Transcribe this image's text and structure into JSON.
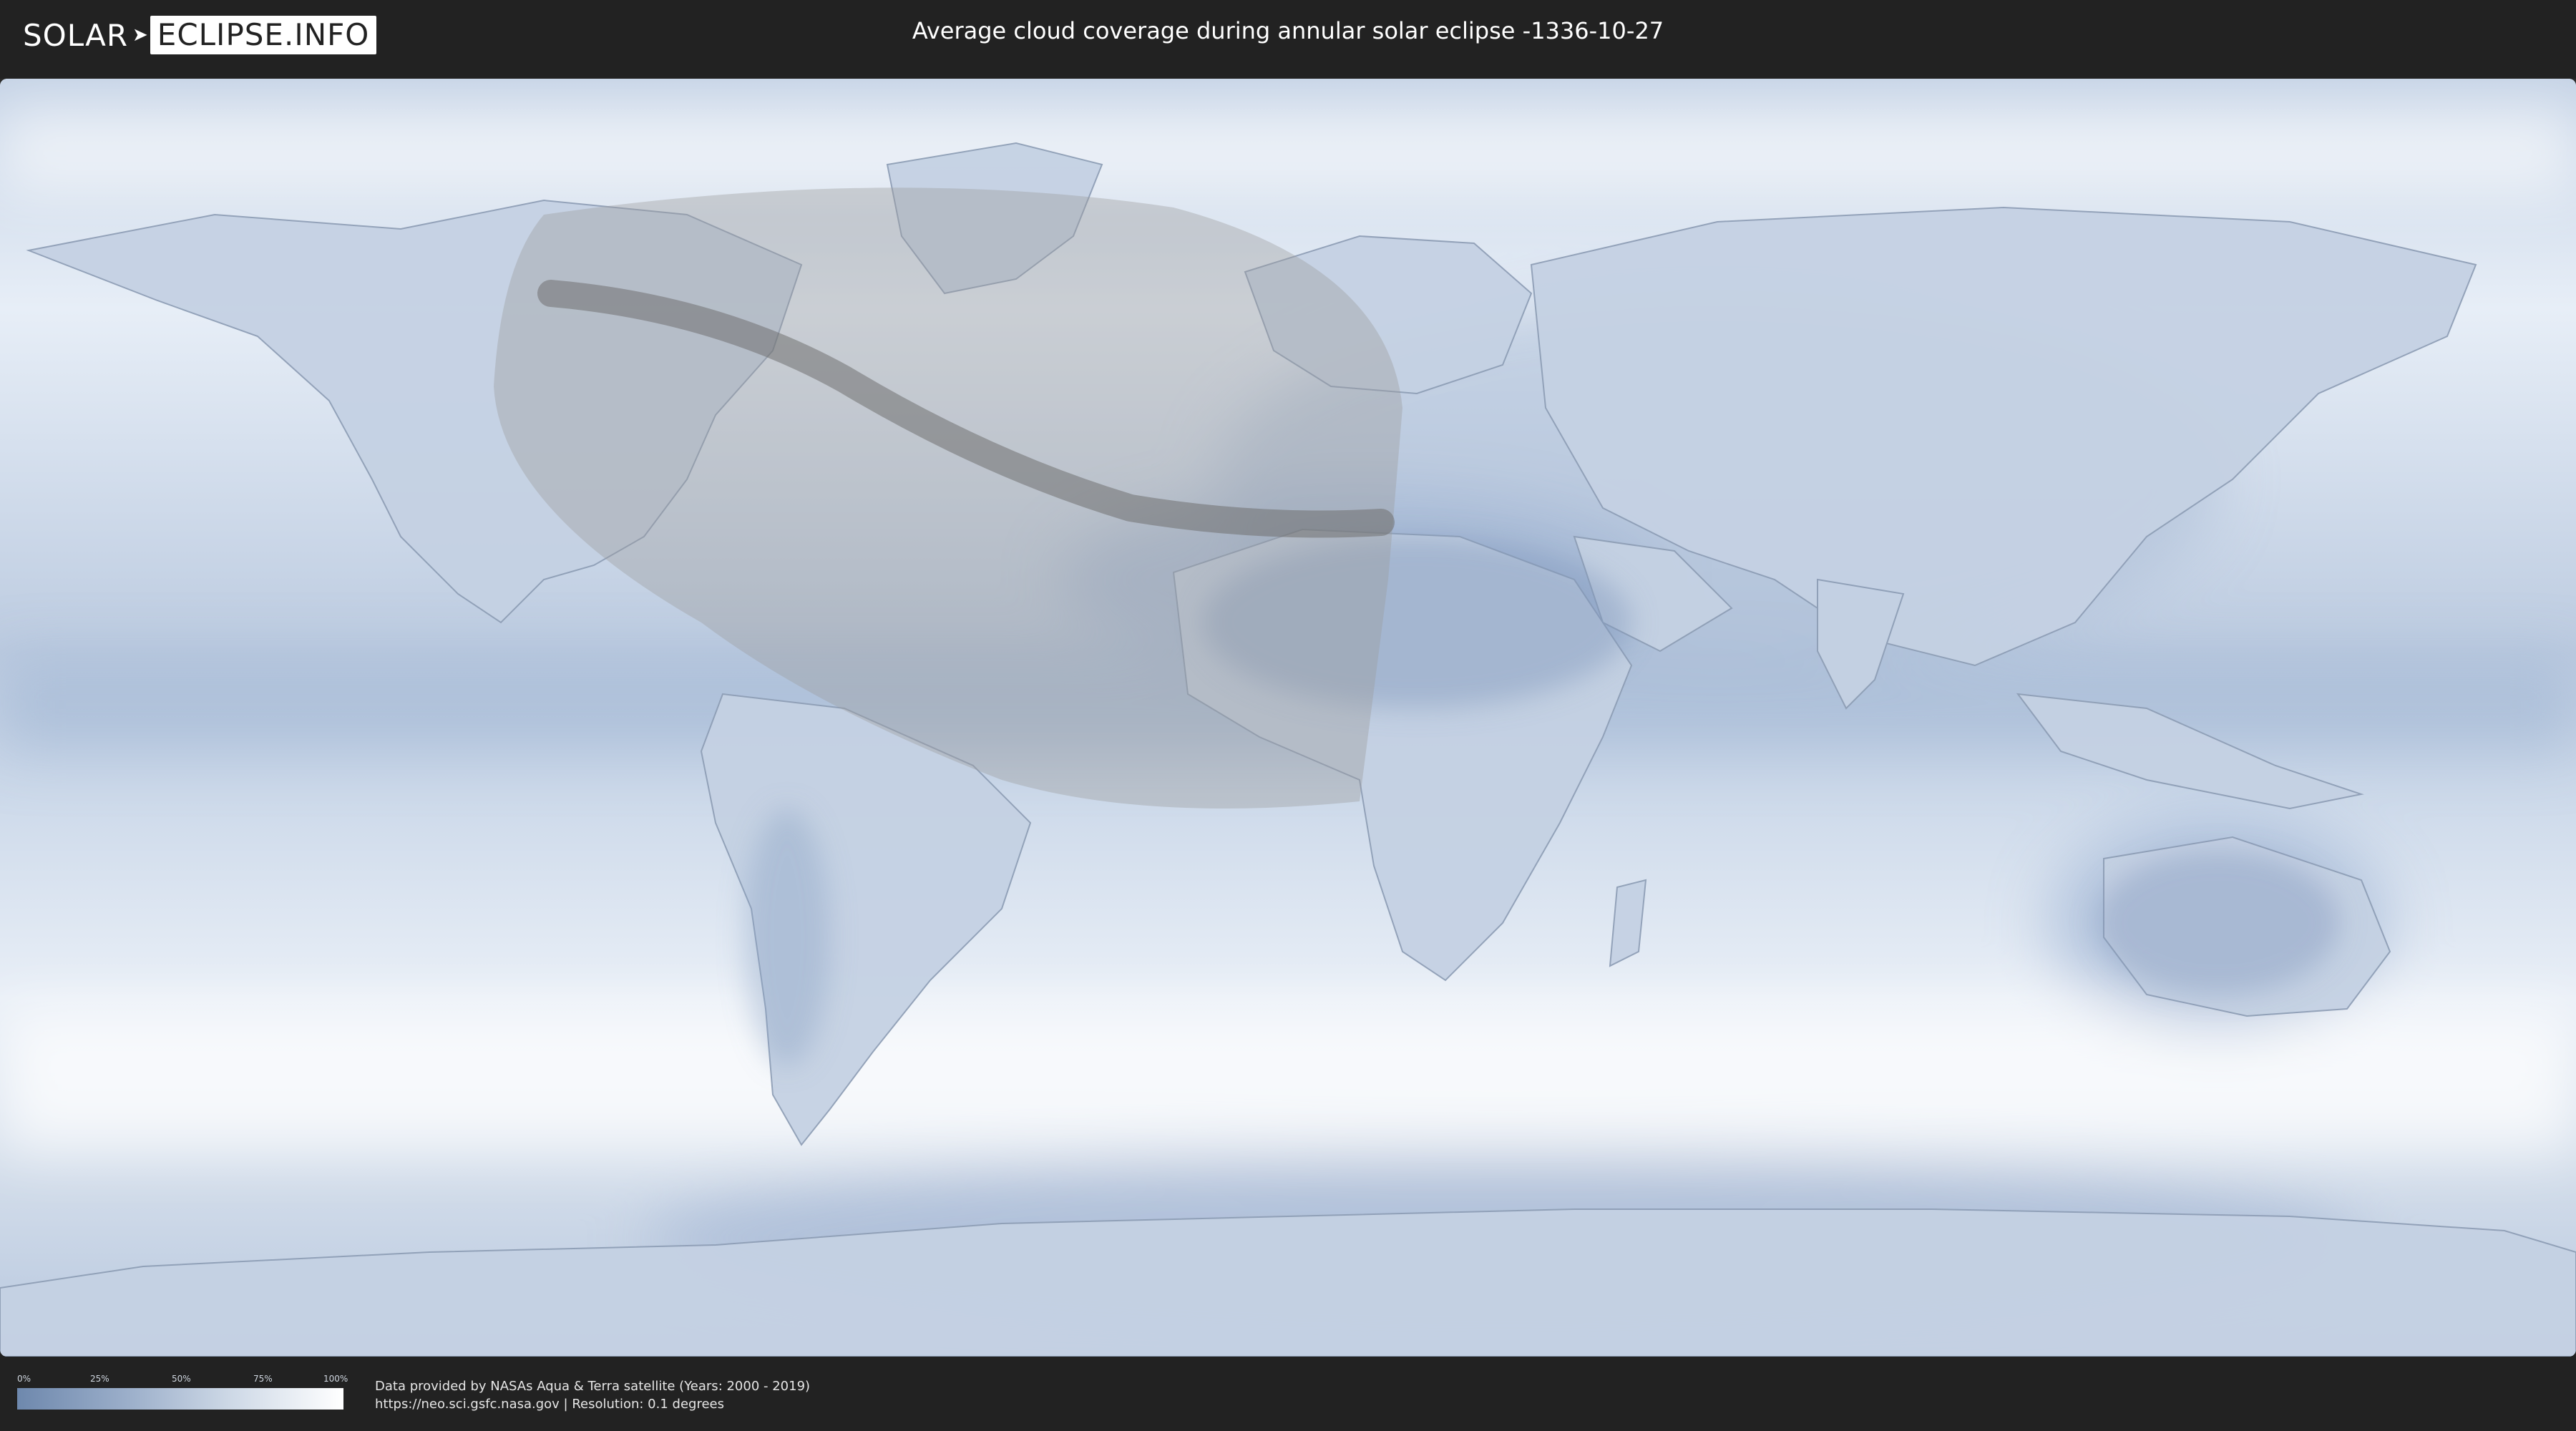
{
  "header": {
    "logo_left": "SOLAR",
    "logo_right": "ECLIPSE.INFO",
    "title": "Average cloud coverage during annular solar eclipse -1336-10-27"
  },
  "map": {
    "projection": "equirectangular world map",
    "layers": [
      "cloud-coverage",
      "coastlines",
      "country-borders",
      "eclipse-visibility-zone",
      "annular-path"
    ],
    "colors": {
      "cloud_low": "#6e88ad",
      "cloud_high": "#ffffff",
      "eclipse_zone": "#9a9a9a",
      "annular_path": "#6f6f6f"
    }
  },
  "legend": {
    "ticks": [
      "0%",
      "25%",
      "50%",
      "75%",
      "100%"
    ],
    "gradient_from": "#6e88ad",
    "gradient_to": "#ffffff"
  },
  "credits": {
    "line1": "Data provided by NASAs Aqua & Terra satellite (Years: 2000 - 2019)",
    "line2": "https://neo.sci.gsfc.nasa.gov | Resolution: 0.1 degrees"
  }
}
